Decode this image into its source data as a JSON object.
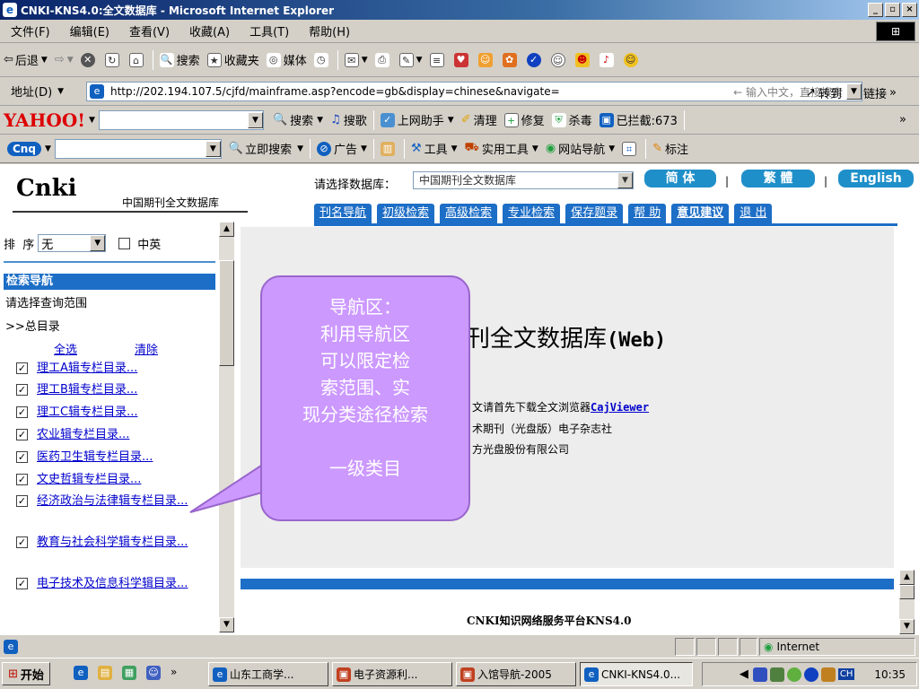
{
  "window": {
    "title": "CNKI-KNS4.0:全文数据库 - Microsoft Internet Explorer",
    "minimize": "_",
    "maximize": "▫",
    "close": "×"
  },
  "menu": [
    "文件(F)",
    "编辑(E)",
    "查看(V)",
    "收藏(A)",
    "工具(T)",
    "帮助(H)"
  ],
  "toolbar": {
    "back": "后退",
    "search": "搜索",
    "favorites": "收藏夹",
    "media": "媒体"
  },
  "address": {
    "label": "地址(D)",
    "url": "http://202.194.107.5/cjfd/mainframe.asp?encode=gb&display=chinese&navigate=",
    "hint": "← 输入中文，直接搜索",
    "go": "转到",
    "links": "链接"
  },
  "yahoo": {
    "logo": "YAHOO!",
    "search": "搜索",
    "music": "搜歌",
    "assistant": "上网助手",
    "clean": "清理",
    "repair": "修复",
    "antivirus": "杀毒",
    "blocked": "已拦截:673"
  },
  "cnbar": {
    "logo": "Cnq",
    "search_now": "立即搜索",
    "ads": "广告",
    "tools": "工具",
    "utilities": "实用工具",
    "site_nav": "网站导航",
    "bookmark": "标注"
  },
  "header": {
    "logo": "Cnki",
    "subtitle": "中国期刊全文数据库",
    "db_label": "请选择数据库：",
    "db_value": "中国期刊全文数据库",
    "lang_simplified": "简 体",
    "lang_traditional": "繁 體",
    "lang_english": "English",
    "sep": "|",
    "tabs": [
      "刊名导航",
      "初级检索",
      "高级检索",
      "专业检索",
      "保存题录",
      "帮 助",
      "意见建议",
      "退 出"
    ]
  },
  "sidebar": {
    "sort_label": "排  序",
    "sort_value": "无",
    "zhongying": "中英",
    "nav_title": "检索导航",
    "prompt": "请选择查询范围",
    "root": ">>总目录",
    "select_all": "全选",
    "clear": "清除",
    "categories": [
      "理工A辑专栏目录...",
      "理工B辑专栏目录...",
      "理工C辑专栏目录...",
      "农业辑专栏目录...",
      "医药卫生辑专栏目录...",
      "文史哲辑专栏目录...",
      "经济政治与法律辑专栏目录...",
      "教育与社会科学辑专栏目录...",
      "电子技术及信息科学辑目录..."
    ]
  },
  "main": {
    "title": "刊全文数据库",
    "title_web": "(Web)",
    "line1": "文请首先下载全文浏览器",
    "cajviewer": "CajViewer",
    "line2": "术期刊（光盘版）电子杂志社",
    "line3": "方光盘股份有限公司",
    "platform": "CNKI知识网络服务平台KNS4.0"
  },
  "callout": {
    "line1": "导航区：",
    "line2": "利用导航区",
    "line3": "可以限定检",
    "line4": "索范围、实",
    "line5": "现分类途径检索",
    "line6": "一级类目"
  },
  "status": {
    "zone": "Internet"
  },
  "taskbar": {
    "start": "开始",
    "tasks": [
      "山东工商学...",
      "电子资源利...",
      "入馆导航-2005",
      "CNKI-KNS4.0..."
    ],
    "ime": "CH",
    "clock": "10:35"
  }
}
